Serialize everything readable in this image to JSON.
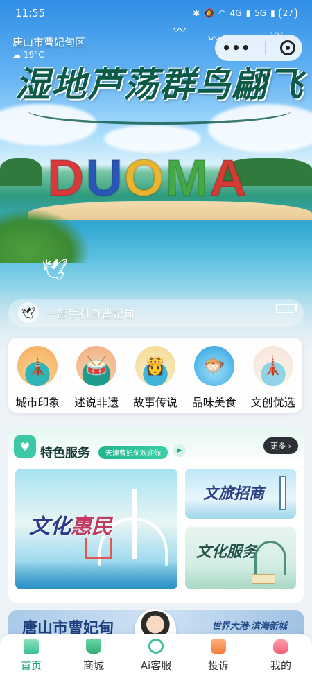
{
  "status_bar": {
    "time": "11:55",
    "network": "4G",
    "network2": "5G",
    "battery": "27"
  },
  "location": {
    "city": "唐山市曹妃甸区",
    "temperature": "19°C"
  },
  "hero": {
    "title": "湿地芦荡群鸟翩飞",
    "sign_letters": [
      "D",
      "U",
      "O",
      "M",
      "A"
    ],
    "sign_colors": [
      "#d9393b",
      "#2a56b8",
      "#e8b530",
      "#45a946",
      "#d33b35"
    ]
  },
  "search": {
    "placeholder": "一部手机游曹妃甸"
  },
  "categories": [
    {
      "label": "城市印象",
      "icon": "tower-icon",
      "bg": "#f7c77d"
    },
    {
      "label": "述说非遗",
      "icon": "drum-icon",
      "bg": "#1f9c8a"
    },
    {
      "label": "故事传说",
      "icon": "lady-icon",
      "bg": "#f4e0a8"
    },
    {
      "label": "品味美食",
      "icon": "fish-icon",
      "bg": "#58b9ea"
    },
    {
      "label": "文创优选",
      "icon": "lighthouse-icon",
      "bg": "#f6e2d6"
    }
  ],
  "services": {
    "title": "特色服务",
    "tag": "天津曹妃甸欢迎你",
    "more": "更多 ›",
    "tiles": {
      "big_part1": "文化",
      "big_part2": "惠民",
      "r1": "文旅招商",
      "r2": "文化服务"
    }
  },
  "bottom_banner": {
    "left": "唐山市曹妃甸",
    "right": "世界大港·滨海新城"
  },
  "tabbar": [
    {
      "label": "首页",
      "icon": "home-icon",
      "color": "#3cc08e"
    },
    {
      "label": "商城",
      "icon": "cart-icon",
      "color": "#3cc08e"
    },
    {
      "label": "Ai客服",
      "icon": "headset-icon",
      "color": "#3cc08e"
    },
    {
      "label": "投诉",
      "icon": "complaint-icon",
      "color": "#f37b3b"
    },
    {
      "label": "我的",
      "icon": "user-icon",
      "color": "#f2607a"
    }
  ]
}
